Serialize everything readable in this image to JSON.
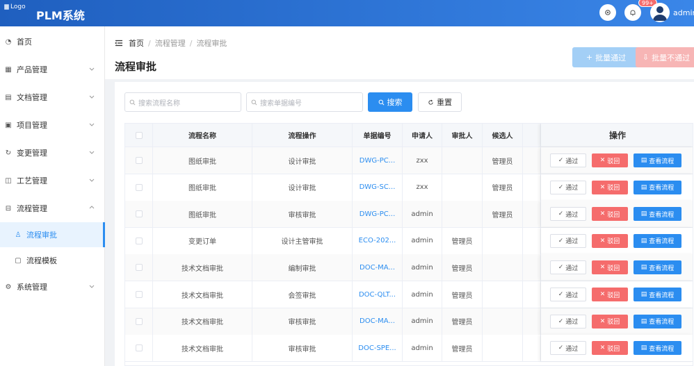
{
  "header": {
    "logo_alt": "Logo",
    "app_title": "PLM系统",
    "notification_badge": "99+",
    "username": "admin"
  },
  "sidebar": {
    "items": [
      {
        "label": "首页",
        "icon": "dashboard-icon"
      },
      {
        "label": "产品管理",
        "icon": "grid-icon",
        "expandable": true
      },
      {
        "label": "文档管理",
        "icon": "document-icon",
        "expandable": true
      },
      {
        "label": "项目管理",
        "icon": "project-icon",
        "expandable": true
      },
      {
        "label": "变更管理",
        "icon": "change-icon",
        "expandable": true
      },
      {
        "label": "工艺管理",
        "icon": "process-icon",
        "expandable": true
      },
      {
        "label": "流程管理",
        "icon": "flow-icon",
        "expandable": true,
        "expanded": true
      },
      {
        "label": "流程审批",
        "icon": "approval-icon",
        "sub": true,
        "active": true
      },
      {
        "label": "流程模板",
        "icon": "template-icon",
        "sub": true
      },
      {
        "label": "系统管理",
        "icon": "gear-icon",
        "expandable": true
      }
    ]
  },
  "breadcrumb": [
    "首页",
    "流程管理",
    "流程审批"
  ],
  "page_title": "流程审批",
  "batch": {
    "pass_label": "批量通过",
    "reject_label": "批量不通过"
  },
  "search": {
    "flow_name_placeholder": "搜索流程名称",
    "doc_no_placeholder": "搜索单据编号",
    "search_label": "搜索",
    "reset_label": "重置"
  },
  "table": {
    "columns": [
      "流程名称",
      "流程操作",
      "单据编号",
      "申请人",
      "审批人",
      "候选人",
      "操作"
    ],
    "rows": [
      {
        "name": "图纸审批",
        "op": "设计审批",
        "doc": "DWG-PC...",
        "applicant": "zxx",
        "approver": "",
        "candidate": "管理员"
      },
      {
        "name": "图纸审批",
        "op": "设计审批",
        "doc": "DWG-SC...",
        "applicant": "zxx",
        "approver": "",
        "candidate": "管理员"
      },
      {
        "name": "图纸审批",
        "op": "审核审批",
        "doc": "DWG-PC...",
        "applicant": "admin",
        "approver": "",
        "candidate": "管理员"
      },
      {
        "name": "变更订单",
        "op": "设计主管审批",
        "doc": "ECO-202...",
        "applicant": "admin",
        "approver": "管理员",
        "candidate": ""
      },
      {
        "name": "技术文档审批",
        "op": "编制审批",
        "doc": "DOC-MA...",
        "applicant": "admin",
        "approver": "管理员",
        "candidate": ""
      },
      {
        "name": "技术文档审批",
        "op": "会签审批",
        "doc": "DOC-QLT...",
        "applicant": "admin",
        "approver": "管理员",
        "candidate": ""
      },
      {
        "name": "技术文档审批",
        "op": "审核审批",
        "doc": "DOC-MA...",
        "applicant": "admin",
        "approver": "管理员",
        "candidate": ""
      },
      {
        "name": "技术文档审批",
        "op": "审核审批",
        "doc": "DOC-SPE...",
        "applicant": "admin",
        "approver": "管理员",
        "candidate": ""
      }
    ],
    "actions": {
      "pass": "通过",
      "reject": "驳回",
      "view": "查看流程"
    }
  },
  "colors": {
    "primary": "#2b8df0",
    "danger": "#f56c6c",
    "header": "#1f5fbf"
  }
}
